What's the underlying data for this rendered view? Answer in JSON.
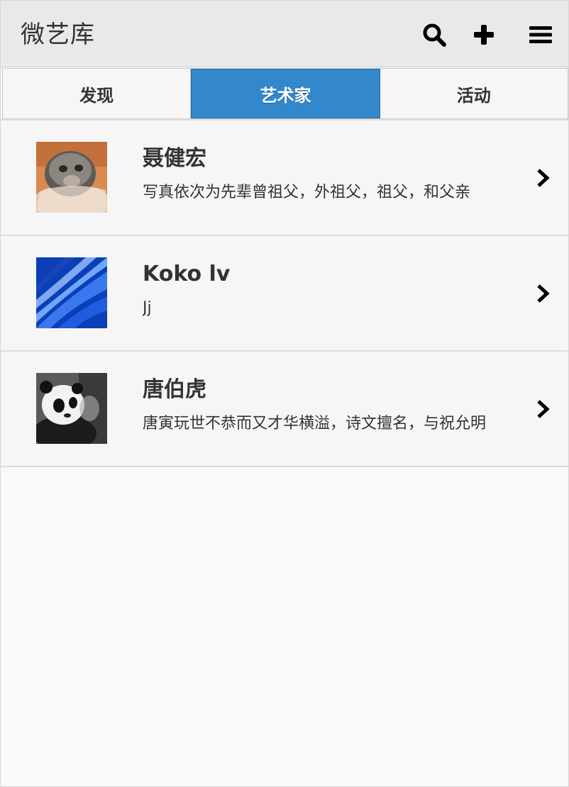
{
  "header": {
    "title": "微艺库",
    "icons": {
      "search": "search-icon",
      "add": "plus-icon",
      "menu": "menu-icon"
    }
  },
  "tabs": [
    {
      "label": "发现",
      "active": false
    },
    {
      "label": "艺术家",
      "active": true
    },
    {
      "label": "活动",
      "active": false
    }
  ],
  "colors": {
    "accent": "#3388cc",
    "header_bg": "#e9e9e9",
    "page_bg": "#f9f9f9",
    "text": "#333333"
  },
  "artists": [
    {
      "name": "聂健宏",
      "description": "写真依次为先辈曾祖父，外祖父，祖父，和父亲",
      "avatar": "chinchilla-photo"
    },
    {
      "name": "Koko lv",
      "description": "Jj",
      "avatar": "blue-tunnel-photo"
    },
    {
      "name": "唐伯虎",
      "description": "唐寅玩世不恭而又才华横溢，诗文擅名，与祝允明",
      "avatar": "panda-photo"
    }
  ]
}
